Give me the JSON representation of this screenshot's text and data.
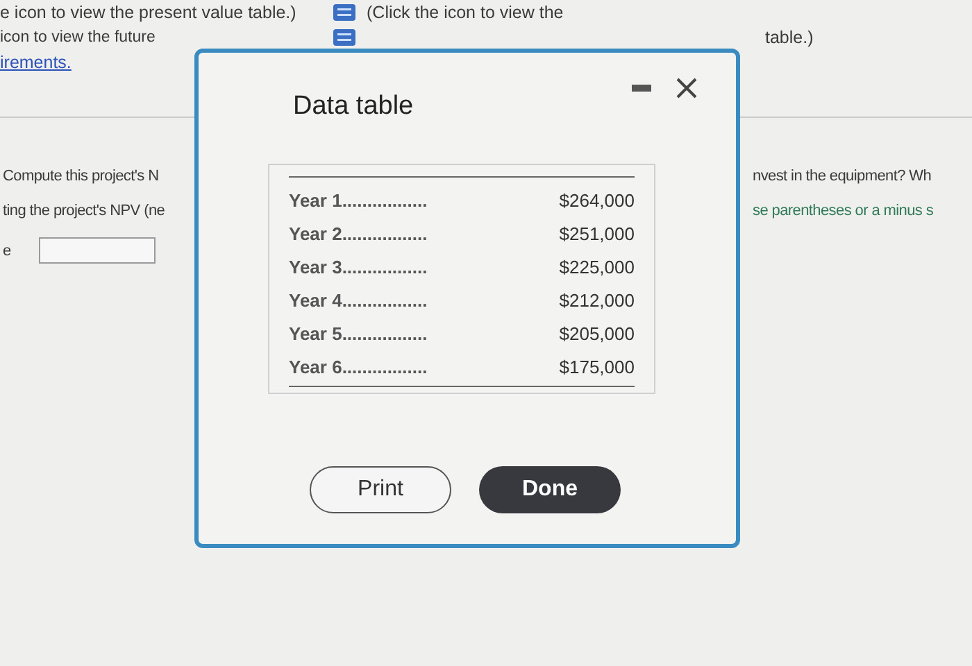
{
  "background": {
    "lines": [
      {
        "left": "e icon to view the present value table.)",
        "right": "(Click the icon to view the"
      },
      {
        "left": "icon to view the future",
        "right": "table.)"
      }
    ],
    "link": "irements.",
    "question": {
      "left": [
        "Compute this project's N",
        "ting the project's NPV (ne"
      ],
      "right": [
        "nvest in the equipment? Wh",
        "se parentheses or a minus s"
      ],
      "field_label": "e"
    }
  },
  "dialog": {
    "title": "Data table",
    "rows": [
      {
        "label": "Year 1.................",
        "value": "$264,000"
      },
      {
        "label": "Year 2.................",
        "value": "$251,000"
      },
      {
        "label": "Year 3.................",
        "value": "$225,000"
      },
      {
        "label": "Year 4.................",
        "value": "$212,000"
      },
      {
        "label": "Year 5.................",
        "value": "$205,000"
      },
      {
        "label": "Year 6.................",
        "value": "$175,000"
      }
    ],
    "buttons": [
      {
        "label": "Print",
        "kind": "secondary"
      },
      {
        "label": "Done",
        "kind": "primary"
      }
    ]
  }
}
